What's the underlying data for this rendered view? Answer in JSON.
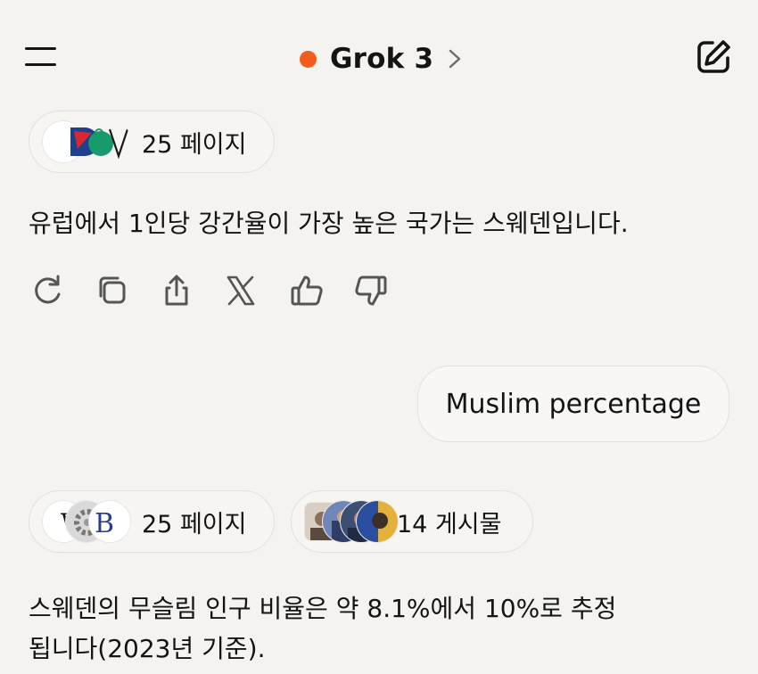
{
  "header": {
    "model_name": "Grok 3",
    "status_color": "#f35c1c",
    "menu_icon": "hamburger-icon",
    "edit_icon": "compose-icon"
  },
  "messages": [
    {
      "role": "assistant",
      "sources": [
        {
          "label": "25 페이지",
          "favicons": [
            "wikipedia-icon",
            "dow-flag-icon",
            "green-circle-icon"
          ]
        }
      ],
      "text": "유럽에서 1인당 강간율이 가장 높은 국가는 스웨덴입니다.",
      "actions": [
        {
          "name": "regenerate",
          "icon": "refresh-icon"
        },
        {
          "name": "copy",
          "icon": "copy-icon"
        },
        {
          "name": "share",
          "icon": "share-icon"
        },
        {
          "name": "post-to-x",
          "icon": "x-logo-icon"
        },
        {
          "name": "like",
          "icon": "thumbs-up-icon"
        },
        {
          "name": "dislike",
          "icon": "thumbs-down-icon"
        }
      ]
    },
    {
      "role": "user",
      "text": "Muslim percentage"
    },
    {
      "role": "assistant",
      "sources": [
        {
          "label": "25 페이지",
          "favicons": [
            "wikipedia-icon",
            "gear-avatar-icon",
            "b-logo-icon"
          ]
        },
        {
          "label": "14 게시물",
          "favicons": [
            "post-avatar-1",
            "post-avatar-2",
            "post-avatar-3",
            "post-avatar-4"
          ]
        }
      ],
      "text_lines": [
        "스웨덴의 무슬림 인구 비율은 약 8.1%에서 10%로 추정",
        "됩니다(2023년 기준)."
      ]
    }
  ]
}
